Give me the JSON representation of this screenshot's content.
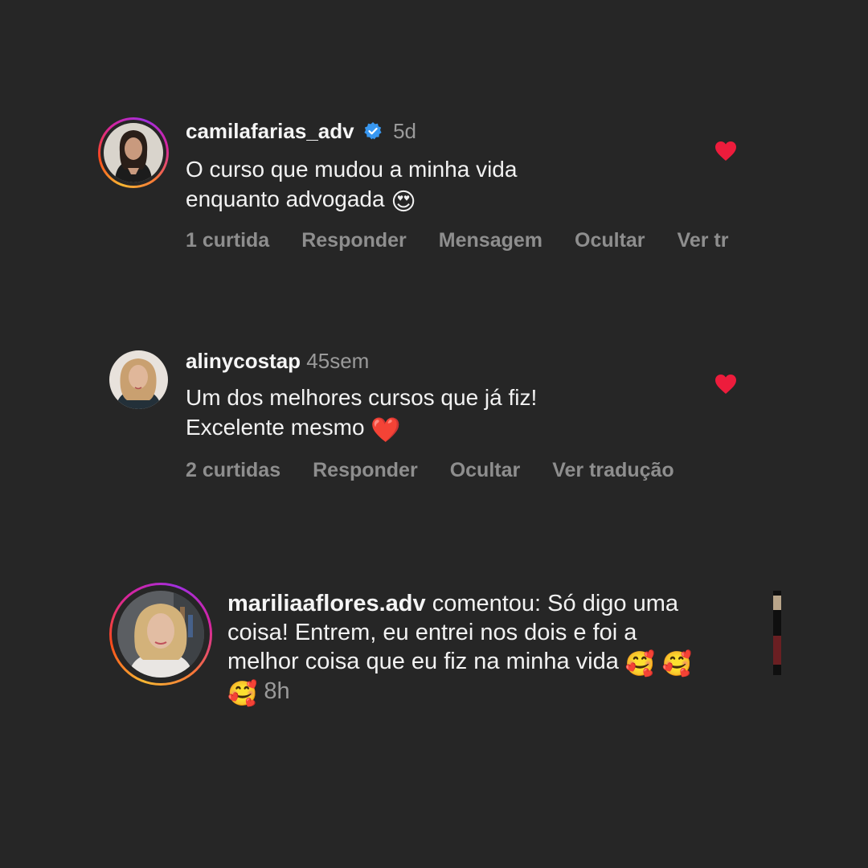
{
  "comments": [
    {
      "username": "camilafarias_adv",
      "verified": true,
      "time": "5d",
      "text_line1": "O curso que mudou a minha vida",
      "text_line2": "enquanto advogada",
      "emoji": "😍",
      "actions": [
        "1 curtida",
        "Responder",
        "Mensagem",
        "Ocultar",
        "Ver tr"
      ],
      "liked": true
    },
    {
      "username": "alinycostap",
      "time": "45sem",
      "text_line1": "Um dos melhores cursos que já fiz!",
      "text_line2": "Excelente mesmo",
      "emoji": "❤️",
      "actions": [
        "2 curtidas",
        "Responder",
        "Ocultar",
        "Ver tradução"
      ],
      "liked": true
    }
  ],
  "notification": {
    "username": "mariliaaflores.adv",
    "line1_rest": " comentou: Só digo uma",
    "line2": "coisa! Entrem, eu entrei nos dois e foi a",
    "line3": "melhor coisa que eu fiz na minha vida",
    "emojis": "🥰 🥰",
    "trailing_emoji": "🥰",
    "time": "8h"
  },
  "colors": {
    "background": "#262626",
    "heart": "#ed1c3c",
    "verified": "#3897f0",
    "muted": "#8e8e8e"
  }
}
